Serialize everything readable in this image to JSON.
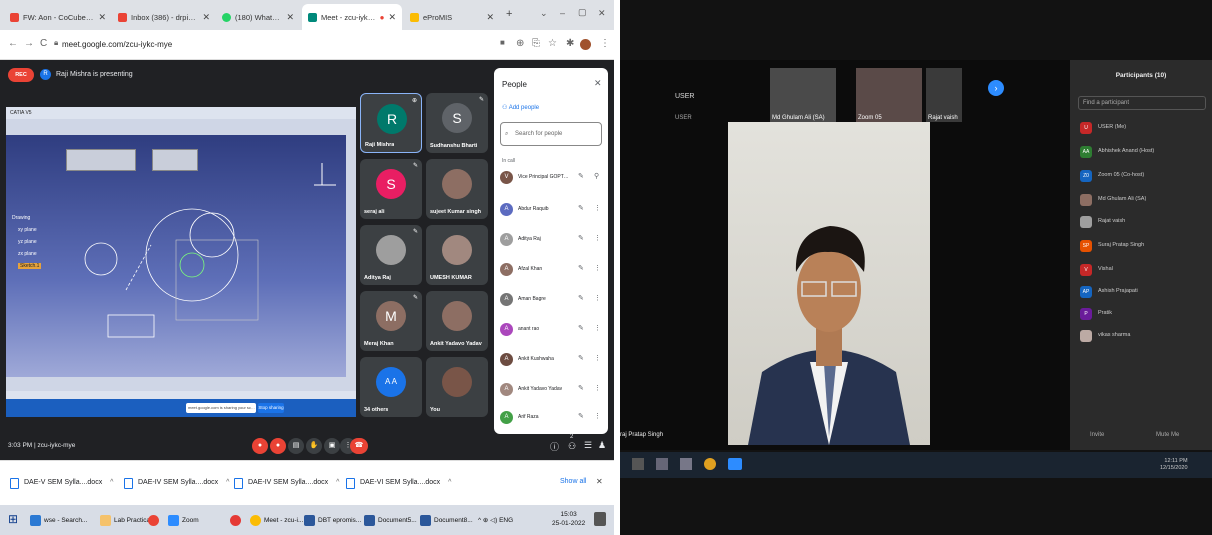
{
  "browser": {
    "tabs": [
      {
        "label": "FW: Aon - CoCubes Invit",
        "color": "#ea4335"
      },
      {
        "label": "Inbox (386) - drpiyushku",
        "color": "#ea4335"
      },
      {
        "label": "(180) WhatsApp",
        "color": "#25d366"
      },
      {
        "label": "Meet - zcu-iykc-mye",
        "color": "#00897b"
      },
      {
        "label": "eProMIS",
        "color": "#fbbc04"
      }
    ],
    "new_tab": "+",
    "window_controls": {
      "minimize": "⌄",
      "restore": "–",
      "maximize": "▢",
      "close": "✕"
    },
    "url": "meet.google.com/zcu-iykc-mye"
  },
  "meet": {
    "rec_label": "REC",
    "presenter_initial": "R",
    "presenting_text": "Raji Mishra is presenting",
    "shared_screen": {
      "notice": "meet.google.com is sharing your screen.",
      "stop_label": "Stop sharing",
      "tree": [
        "Drawing",
        "xy plane",
        "yz plane",
        "zx plane",
        "Sketch.1"
      ]
    },
    "tiles": [
      {
        "name": "Raji Mishra",
        "initial": "R",
        "color": "#00796b"
      },
      {
        "name": "Sudhanshu Bharti",
        "initial": "S",
        "color": "#5f6368"
      },
      {
        "name": "seraj ali",
        "initial": "S",
        "color": "#e91e63"
      },
      {
        "name": "sujeet Kumar singh",
        "initial": "",
        "color": "#8d6e63"
      },
      {
        "name": "Aditya Raj",
        "initial": "",
        "color": "#9e9e9e"
      },
      {
        "name": "UMESH KUMAR",
        "initial": "",
        "color": "#a1887f"
      },
      {
        "name": "Meraj Khan",
        "initial": "M",
        "color": "#8d6e63"
      },
      {
        "name": "Ankit Yadavo Yadav",
        "initial": "",
        "color": "#8d6e63"
      },
      {
        "name": "34 others",
        "initial": "A A",
        "color": "#1a73e8"
      },
      {
        "name": "You",
        "initial": "",
        "color": "#795548"
      }
    ],
    "people": {
      "title": "People",
      "add_people": "Add people",
      "search_placeholder": "Search for people",
      "in_call": "In call",
      "list": [
        {
          "name": "Vice Principal GOPT (You)",
          "initial": "V",
          "color": "#795548"
        },
        {
          "name": "Abdur Raquib",
          "initial": "A",
          "color": "#5c6bc0"
        },
        {
          "name": "Aditya Raj",
          "initial": "A",
          "color": "#9e9e9e"
        },
        {
          "name": "Afzal Khan",
          "initial": "A",
          "color": "#8d6e63"
        },
        {
          "name": "Aman Bagre",
          "initial": "A",
          "color": "#757575"
        },
        {
          "name": "anant rao",
          "initial": "A",
          "color": "#ab47bc"
        },
        {
          "name": "Ankit Kushwaha",
          "initial": "A",
          "color": "#6d4c41"
        },
        {
          "name": "Ankit Yadavo Yadav",
          "initial": "A",
          "color": "#a1887f"
        },
        {
          "name": "Arif Raza",
          "initial": "A",
          "color": "#43a047"
        }
      ]
    },
    "meeting_info": "3:03 PM | zcu-iykc-mye",
    "controls": [
      {
        "icon": "mic-icon",
        "glyph": "●",
        "color": "#ea4335"
      },
      {
        "icon": "camera-icon",
        "glyph": "●",
        "color": "#ea4335"
      },
      {
        "icon": "captions-icon",
        "glyph": "▤",
        "color": "#3c4043"
      },
      {
        "icon": "hand-icon",
        "glyph": "✋",
        "color": "#3c4043"
      },
      {
        "icon": "present-icon",
        "glyph": "▣",
        "color": "#3c4043"
      },
      {
        "icon": "more-icon",
        "glyph": "⋮",
        "color": "#3c4043"
      },
      {
        "icon": "end-call-icon",
        "glyph": "☎",
        "color": "#ea4335"
      }
    ],
    "side_controls": {
      "info": "ⓘ",
      "people_count": "2",
      "chat": "☰",
      "activities": "♟"
    }
  },
  "downloads": {
    "items": [
      "DAE-V SEM Sylla....docx",
      "DAE-IV SEM Sylla....docx",
      "DAE-IV SEM Sylla....docx",
      "DAE-VI SEM Sylla....docx"
    ],
    "chevron": "^",
    "show_all": "Show all",
    "close": "✕"
  },
  "taskbar": {
    "start": "⊞",
    "items": [
      {
        "label": "wse - Search...",
        "color": "#2b79d3"
      },
      {
        "label": "Lab Practical ...",
        "color": "#f5c26b"
      },
      {
        "label": "",
        "color": "#ea4335"
      },
      {
        "label": "Zoom",
        "color": "#2d8cff"
      },
      {
        "label": "",
        "color": "#e53935"
      },
      {
        "label": "Meet - zcu-i...",
        "color": "#fbbc04"
      },
      {
        "label": "DBT epromis...",
        "color": "#2b579a"
      },
      {
        "label": "Document5...",
        "color": "#2b579a"
      },
      {
        "label": "Document8...",
        "color": "#2b579a"
      }
    ],
    "tray": "^ ⊕ ◁) ENG",
    "time": "15:03",
    "date": "25-01-2022"
  },
  "zoom": {
    "user_label": "USER",
    "user_label2": "USER",
    "tiles": [
      "Md Ghulam Ali (SA)",
      "Zoom 05",
      "Rajat vaish"
    ],
    "next": "›",
    "name_overlay": "raj Pratap Singh",
    "participants": {
      "title": "Participants (10)",
      "search_placeholder": "Find a participant",
      "list": [
        {
          "initials": "U",
          "label": "USER (Me)",
          "color": "#c62828"
        },
        {
          "initials": "AA",
          "label": "Abhishek Anand (Host)",
          "color": "#2e7d32"
        },
        {
          "initials": "Z0",
          "label": "Zoom 05 (Co-host)",
          "color": "#1565c0"
        },
        {
          "initials": "",
          "label": "Md Ghulam Ali (SA)",
          "color": "#8d6e63"
        },
        {
          "initials": "",
          "label": "Rajat vaish",
          "color": "#9e9e9e"
        },
        {
          "initials": "SP",
          "label": "Suraj Pratap Singh",
          "color": "#e65100"
        },
        {
          "initials": "V",
          "label": "Vishal",
          "color": "#c62828"
        },
        {
          "initials": "AP",
          "label": "Ashish Prajapati",
          "color": "#1565c0"
        },
        {
          "initials": "P",
          "label": "Pratik",
          "color": "#6a1b9a"
        },
        {
          "initials": "",
          "label": "vikas sharma",
          "color": "#bcaaa4"
        }
      ],
      "invite": "Invite",
      "mute_all": "Mute Me"
    },
    "clock_time": "12:11 PM",
    "clock_date": "12/15/2020"
  }
}
